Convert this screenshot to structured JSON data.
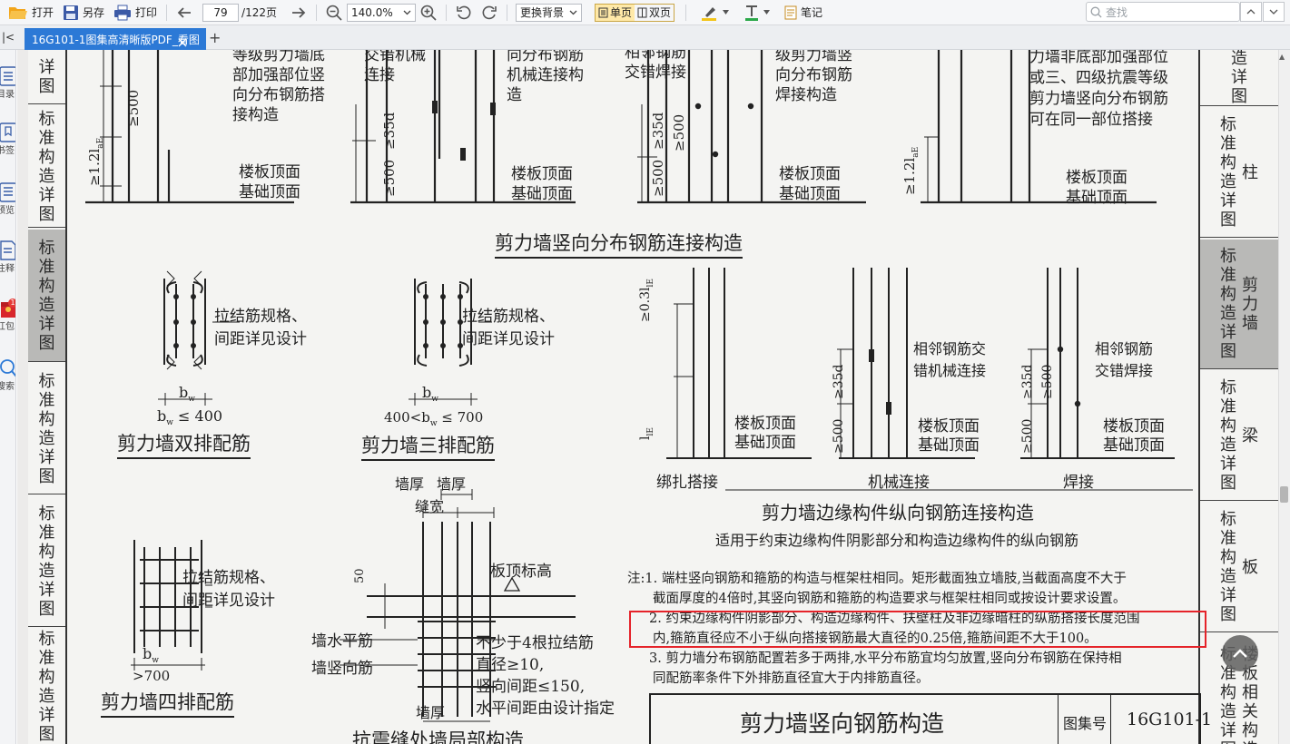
{
  "toolbar": {
    "open": "打开",
    "save_as": "另存",
    "print": "打印",
    "page_current": "79",
    "page_total": "/122页",
    "zoom": "140.0%",
    "background": "更换背景",
    "single_page": "单页",
    "double_page": "双页",
    "notes": "笔记",
    "search_placeholder": "查找"
  },
  "tabs": {
    "active_tab": "16G101-1图集高清晰版PDF_看图"
  },
  "rail": {
    "items": [
      "目录",
      "书签",
      "预览",
      "注释",
      "红包",
      "搜索"
    ],
    "badge": "1"
  },
  "doc": {
    "side_tabs": [
      {
        "chars": "标准构造详图",
        "suffix": "柱"
      },
      {
        "chars": "标准构造详图",
        "suffix": "剪力墙"
      },
      {
        "chars": "标准构造详图",
        "suffix": "梁"
      },
      {
        "chars": "标准构造详图",
        "suffix": "板"
      },
      {
        "chars": "标准构造详图",
        "suffix": "楼板相关构造"
      }
    ],
    "top_tab_partial": "造详图",
    "left_partial_tabs": [
      "详图",
      "标准构造详图",
      "标准构造详图",
      "标准构造详图",
      "标准构造详图",
      "标准构造详图"
    ],
    "top_texts": {
      "t1": "等级剪力墙底",
      "t2": "部加强部位竖",
      "t3": "向分布钢筋搭",
      "t4": "接构造",
      "t5": "交错机械",
      "t6": "连接",
      "t7": "向分布钢筋",
      "t8": "机械连接构",
      "t9": "造",
      "t10": "相邻钢筋",
      "t11": "交错焊接",
      "t12": "级剪力墙竖",
      "t13": "向分布钢筋",
      "t14": "焊接构造",
      "t15": "力墙非底部加强部位",
      "t16": "或三、四级抗震等级",
      "t17": "剪力墙竖向分布钢筋",
      "t18": "可在同一部位搭接",
      "slab_top": "楼板顶面",
      "foundation_top": "基础顶面"
    },
    "dims": {
      "d500": "≥500",
      "d12lae": "≥1.2l",
      "d35d": "≥35d",
      "d03l": "≥0.3l",
      "lle": "l"
    },
    "heading_vertical": "剪力墙竖向分布钢筋连接构造",
    "double_row": {
      "title": "剪力墙双排配筋",
      "note1": "拉结筋规格、",
      "note2": "间距详见设计",
      "bw": "b",
      "cond": "b",
      "cond_rest": " ≤ 400"
    },
    "triple_row": {
      "title": "剪力墙三排配筋",
      "note1": "拉结筋规格、",
      "note2": "间距详见设计",
      "cond_pre": "400<b",
      "cond_rest": " ≤ 700"
    },
    "quad_row": {
      "title": "剪力墙四排配筋",
      "note1": "拉结筋规格、",
      "note2": "间距详见设计",
      "cond": ">700"
    },
    "edge": {
      "lap": "绑扎搭接",
      "mech": "机械连接",
      "weld": "焊接",
      "mech_note1": "相邻钢筋交",
      "mech_note2": "错机械连接",
      "weld_note1": "相邻钢筋",
      "weld_note2": "交错焊接",
      "title": "剪力墙边缘构件纵向钢筋连接构造",
      "subtitle": "适用于约束边缘构件阴影部分和构造边缘构件的纵向钢筋"
    },
    "seam": {
      "wall_thk1": "墙厚",
      "wall_thk2": "墙厚",
      "seam_w": "缝宽",
      "slab_top": "板顶标高",
      "dim50": "50",
      "horiz": "墙水平筋",
      "vert": "墙竖向筋",
      "n1": "不少于4根拉结筋",
      "n2": "直径≥10,",
      "n3": "竖向间距≤150,",
      "n4": "水平间距由设计指定",
      "wall_thk3": "墙厚",
      "title": "抗震缝处墙局部构造"
    },
    "notes": {
      "n1a": "注:1. 端柱竖向钢筋和箍筋的构造与框架柱相同。矩形截面独立墙肢,当截面高度不大于",
      "n1b": "截面厚度的4倍时,其竖向钢筋和箍筋的构造要求与框架柱相同或按设计要求设置。",
      "n2a": "2. 约束边缘构件阴影部分、构造边缘构件、扶壁柱及非边缘暗柱的纵筋搭接长度范围",
      "n2b": "内,箍筋直径应不小于纵向搭接钢筋最大直径的0.25倍,箍筋间距不大于100。",
      "n3a": "3. 剪力墙分布钢筋配置若多于两排,水平分布筋宜均匀放置,竖向分布钢筋在保持相",
      "n3b": "同配筋率条件下外排筋直径宜大于内排筋直径。"
    },
    "title_block": {
      "title": "剪力墙竖向钢筋构造",
      "atlas_label": "图集号",
      "atlas_no": "16G101-1"
    }
  },
  "colors": {
    "tab_active": "#2c79d6",
    "highlight_box": "#e5232a",
    "side_tab_active": "#b9b9b7"
  }
}
